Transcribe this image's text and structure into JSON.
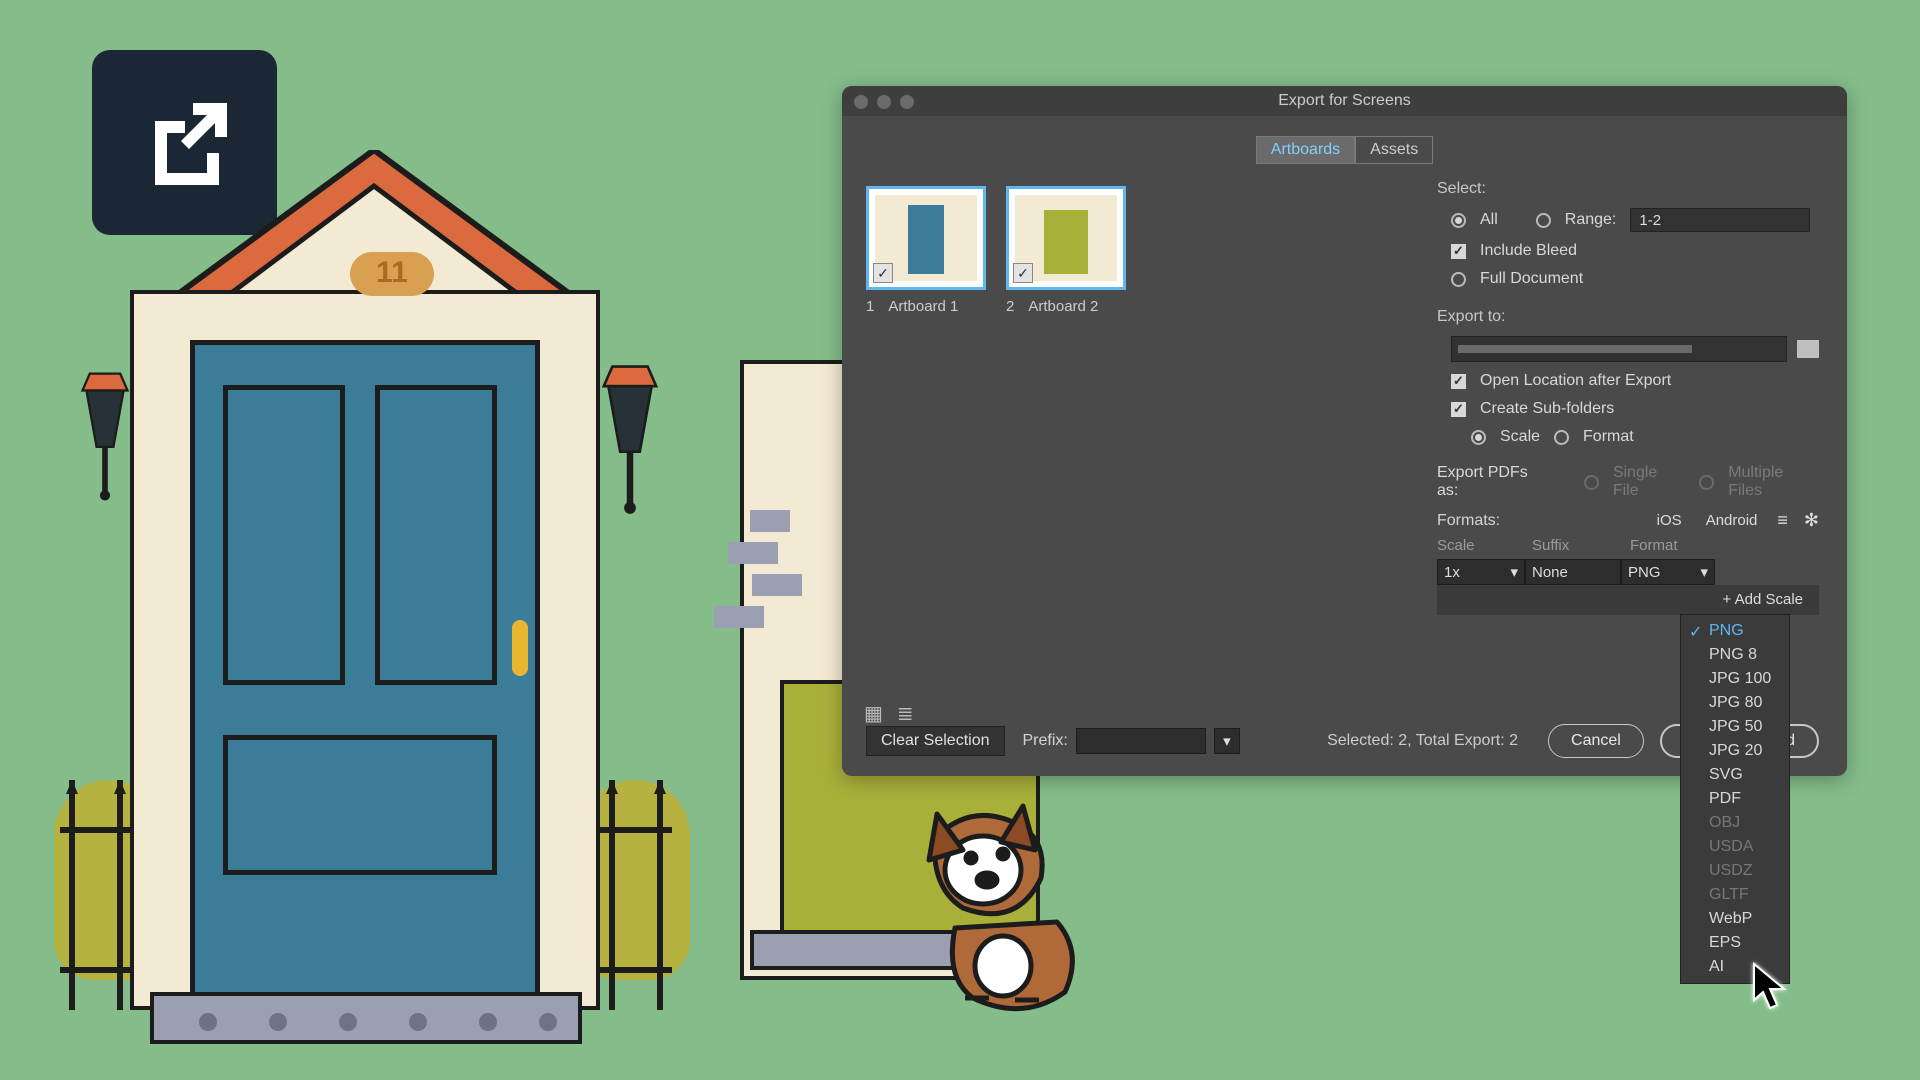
{
  "dialog": {
    "title": "Export for Screens",
    "tabs": {
      "artboards": "Artboards",
      "assets": "Assets"
    },
    "thumbs": [
      {
        "index": "1",
        "label": "Artboard 1"
      },
      {
        "index": "2",
        "label": "Artboard 2"
      }
    ],
    "clear_selection": "Clear Selection",
    "prefix_label": "Prefix:",
    "selected_text": "Selected: 2, Total Export: 2",
    "cancel": "Cancel",
    "export_btn": "Export Artboard"
  },
  "right": {
    "select_label": "Select:",
    "all": "All",
    "range_label": "Range:",
    "range_value": "1-2",
    "include_bleed": "Include Bleed",
    "full_document": "Full Document",
    "export_to": "Export to:",
    "open_location": "Open Location after Export",
    "create_subfolders": "Create Sub-folders",
    "scale_radio": "Scale",
    "format_radio": "Format",
    "export_pdfs": "Export PDFs as:",
    "single_file": "Single File",
    "multiple_files": "Multiple Files",
    "formats_label": "Formats:",
    "ios": "iOS",
    "android": "Android",
    "col_scale": "Scale",
    "col_suffix": "Suffix",
    "col_format": "Format",
    "scale_value": "1x",
    "suffix_value": "None",
    "format_value": "PNG",
    "add_scale": "+ Add Scale"
  },
  "dropdown": {
    "items": [
      {
        "label": "PNG",
        "state": "selected"
      },
      {
        "label": "PNG 8",
        "state": ""
      },
      {
        "label": "JPG 100",
        "state": ""
      },
      {
        "label": "JPG 80",
        "state": ""
      },
      {
        "label": "JPG 50",
        "state": ""
      },
      {
        "label": "JPG 20",
        "state": ""
      },
      {
        "label": "SVG",
        "state": ""
      },
      {
        "label": "PDF",
        "state": ""
      },
      {
        "label": "OBJ",
        "state": "disabled"
      },
      {
        "label": "USDA",
        "state": "disabled"
      },
      {
        "label": "USDZ",
        "state": "disabled"
      },
      {
        "label": "GLTF",
        "state": "disabled"
      },
      {
        "label": "WebP",
        "state": ""
      },
      {
        "label": "EPS",
        "state": ""
      },
      {
        "label": "AI",
        "state": ""
      }
    ]
  },
  "house_number": "11"
}
